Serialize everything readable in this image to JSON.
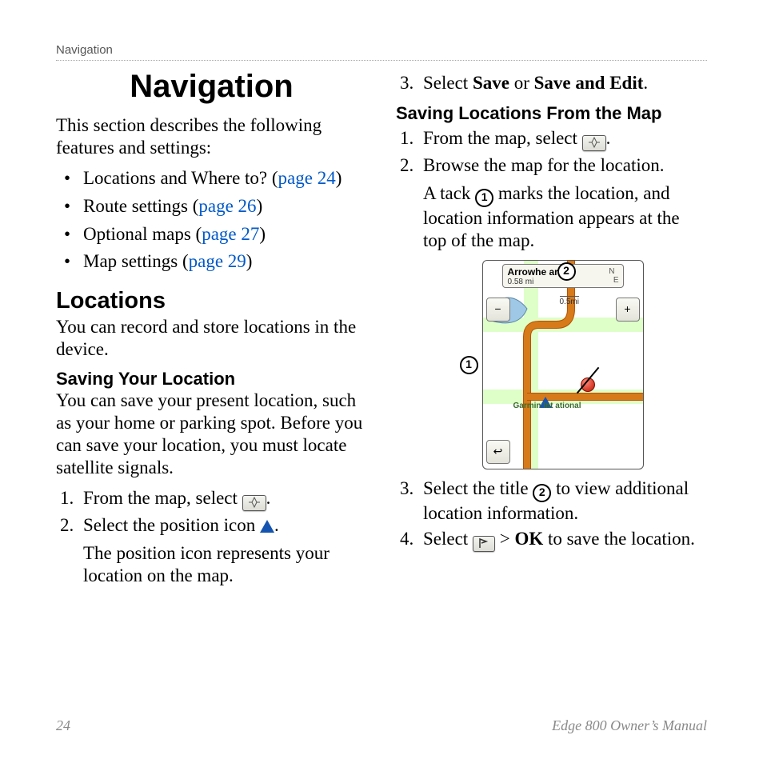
{
  "running_head": "Navigation",
  "left": {
    "title": "Navigation",
    "intro": "This section describes the following features and settings:",
    "bullets": [
      {
        "text": "Locations and Where to? (",
        "link": "page 24",
        "after": ")"
      },
      {
        "text": "Route settings (",
        "link": "page 26",
        "after": ")"
      },
      {
        "text": "Optional maps (",
        "link": "page 27",
        "after": ")"
      },
      {
        "text": "Map settings (",
        "link": "page 29",
        "after": ")"
      }
    ],
    "h2": "Locations",
    "h2_body": "You can record and store locations in the device.",
    "h3": "Saving Your Location",
    "h3_body": "You can save your present location, such as your home or parking spot. Before you can save your location, you must locate satellite signals.",
    "steps": {
      "s1a": "From the map, select ",
      "s1b": ".",
      "s2a": "Select the position icon ",
      "s2b": ".",
      "s2_note": "The position icon represents your location on the map."
    }
  },
  "right": {
    "step3_a": "Select ",
    "step3_b": "Save",
    "step3_c": " or ",
    "step3_d": "Save and Edit",
    "step3_e": ".",
    "h3": "Saving Locations From the Map",
    "s1a": "From the map, select ",
    "s1b": ".",
    "s2": "Browse the map for the location.",
    "s2_note_a": "A tack ",
    "s2_note_b": " marks the location, and location information appears at the top of the map.",
    "s3_a": "Select the title ",
    "s3_b": " to view additional location information.",
    "s4_a": "Select ",
    "s4_b": " > ",
    "s4_c": "OK",
    "s4_d": " to save the location.",
    "circled1": "1",
    "circled2": "2",
    "map": {
      "title": "Arrowhe      ark",
      "sub": "0.58 mi",
      "compass_n": "N",
      "compass_e": "E",
      "scale": "0.5mi",
      "garmin": "Garmin Int    ational",
      "minus": "−",
      "plus": "+",
      "back": "↩"
    }
  },
  "footer": {
    "page": "24",
    "doc": "Edge 800 Owner’s Manual"
  }
}
